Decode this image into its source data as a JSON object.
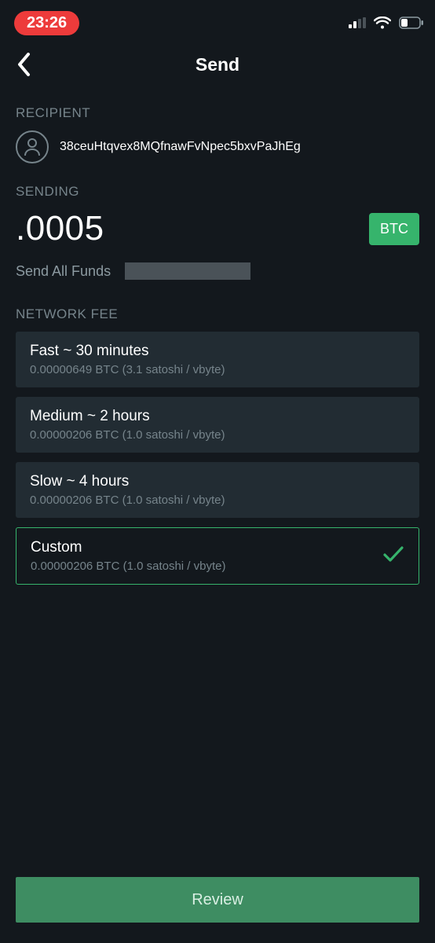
{
  "status": {
    "time": "23:26"
  },
  "header": {
    "title": "Send"
  },
  "recipient": {
    "label": "RECIPIENT",
    "address": "38ceuHtqvex8MQfnawFvNpec5bxvPaJhEg"
  },
  "sending": {
    "label": "SENDING",
    "amount": ".0005",
    "currency": "BTC",
    "send_all": "Send All Funds"
  },
  "network_fee": {
    "label": "NETWORK FEE",
    "options": [
      {
        "title": "Fast  ~ 30 minutes",
        "sub": "0.00000649 BTC (3.1 satoshi / vbyte)",
        "selected": false
      },
      {
        "title": "Medium  ~ 2 hours",
        "sub": "0.00000206 BTC (1.0 satoshi / vbyte)",
        "selected": false
      },
      {
        "title": "Slow  ~ 4 hours",
        "sub": "0.00000206 BTC (1.0 satoshi / vbyte)",
        "selected": false
      },
      {
        "title": "Custom",
        "sub": "0.00000206 BTC (1.0 satoshi / vbyte)",
        "selected": true
      }
    ]
  },
  "footer": {
    "review": "Review"
  },
  "colors": {
    "accent": "#36b46c",
    "bg": "#13181d",
    "card": "#222c33"
  }
}
